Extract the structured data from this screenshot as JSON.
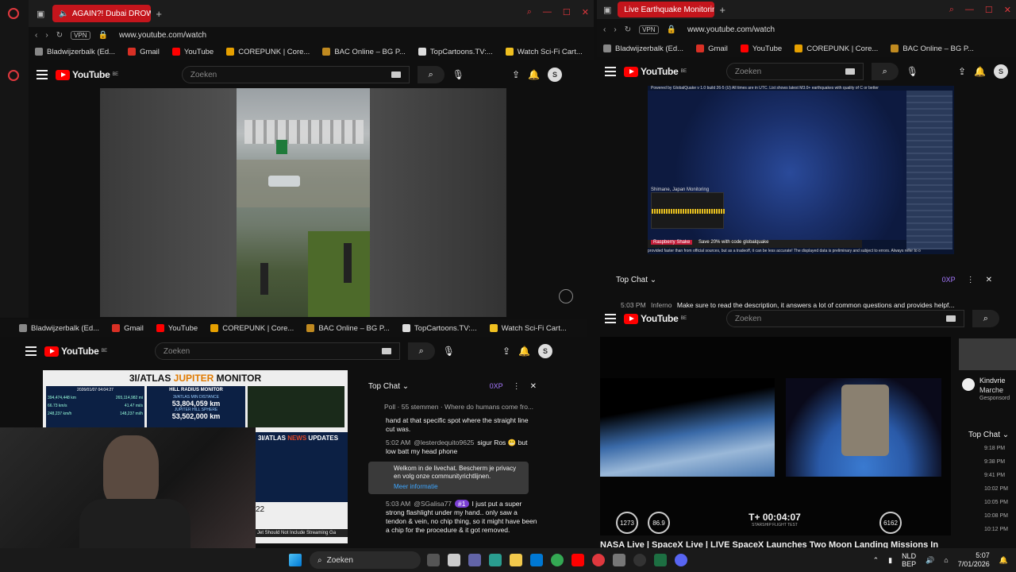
{
  "win1": {
    "tab_title": "AGAIN?! Dubai DROWN",
    "url": "www.youtube.com/watch",
    "vpn": "VPN",
    "bookmarks": [
      "Bladwijzerbalk (Ed...",
      "Gmail",
      "YouTube",
      "COREPUNK | Core...",
      "BAC Online – BG P...",
      "TopCartoons.TV:...",
      "Watch Sci-Fi Cart..."
    ],
    "search_placeholder": "Zoeken",
    "avatar": "S"
  },
  "win2": {
    "tab_title": "Live Earthquake Monitoring",
    "url": "www.youtube.com/watch",
    "vpn": "VPN",
    "bookmarks": [
      "Bladwijzerbalk (Ed...",
      "Gmail",
      "YouTube",
      "COREPUNK | Core...",
      "BAC Online – BG P..."
    ],
    "search_placeholder": "Zoeken",
    "avatar": "S",
    "video_banner": "Powered by GlobalQuake v 1.0 build 26-5 (U)     All times are in UTC. List shows latest M3.0+ earthquakes with quality of C or better",
    "shimane": "Shimane, Japan Monitoring",
    "promo": "Save 20% with code globalquake",
    "promo_brand": "Raspberry Shake",
    "footer_text": "provided faster than from official sources, but as a tradeoff, it can be less accurate! The displayed data is preliminary and subject to errors. Always refer to o",
    "chat_title": "Top Chat",
    "xp": "0XP",
    "pinned_time": "5:03 PM",
    "pinned_user": "Inferno",
    "pinned_msg": "Make sure to read the description, it answers a lot of common questions and provides helpf..."
  },
  "win3": {
    "bookmarks": [
      "Bladwijzerbalk (Ed...",
      "Gmail",
      "YouTube",
      "COREPUNK | Core...",
      "BAC Online – BG P...",
      "TopCartoons.TV:...",
      "Watch Sci-Fi Cart..."
    ],
    "search_placeholder": "Zoeken",
    "avatar": "S",
    "monitor_title_a": "3I/ATLAS ",
    "monitor_title_b": "JUPITER",
    "monitor_title_c": " MONITOR",
    "date_line": "2026/01/07 04:04:27",
    "hill_title": "HILL RADIUS MONITOR",
    "atlas_dist_label": "3I/ATLAS MIN DISTANCE",
    "atlas_dist": "53,804,059 km",
    "sphere_label": "JUPITER HILL SPHERE",
    "sphere_val": "53,502,000 km",
    "left_vals": [
      "394,474,448 km",
      "66.73 km/s",
      "248,237 km/h"
    ],
    "right_vals": [
      "265,114,982 mi",
      "41.47 mi/s",
      "148,237 mi/h"
    ],
    "news_a": "3I/ATLAS ",
    "news_b": "NEWS",
    "news_c": " UPDATES",
    "side_num": "22",
    "news_ticker": "Jet Should Not Include Streaming Ga",
    "chat_title": "Top Chat",
    "xp": "0XP",
    "messages": [
      {
        "time": "",
        "user": "Poll · 55 stemmen · Where do humans come fro...",
        "text": ""
      },
      {
        "time": "",
        "user": "",
        "text": "hand at that specific spot where the straight line cut was."
      },
      {
        "time": "5:02 AM",
        "user": "@lesterdequito9625",
        "text": "sigur Ros 😬 but low batt my head phone"
      },
      {
        "time": "5:03 AM",
        "user": "@SGalisa77",
        "text": "I just put a super strong flashlight under my hand.. only saw a tendon & vein, no chip thing, so it might have been a chip for the procedure & it got removed."
      }
    ],
    "welcome_msg": "Welkom in de livechat. Bescherm je privacy en volg onze communityrichtlijnen.",
    "welcome_link": "Meer informatie",
    "badge": "#1"
  },
  "win4": {
    "search_placeholder": "Zoeken",
    "telemetry_left": [
      "1273",
      "86.9"
    ],
    "telemetry_right": "6162",
    "timer": "T+ 00:04:07",
    "timer_sub": "STARSHIP FLIGHT TEST",
    "video_title": "NASA Live | SpaceX Live | LIVE SpaceX Launches Two Moon Landing Missions In",
    "side_name": "Kindvrie",
    "side_sub": "Marche",
    "side_sub2": "Gesponsord",
    "chat_title": "Top Chat",
    "chat_times": [
      "9:18 PM",
      "9:38 PM",
      "9:41 PM",
      "10:02 PM",
      "10:05 PM",
      "10:08 PM",
      "10:12 PM"
    ]
  },
  "taskbar": {
    "search": "Zoeken",
    "lang1": "NLD",
    "lang2": "BEP",
    "time": "5:07",
    "date": "7/01/2026"
  },
  "colors": {
    "accent_red": "#c4151c",
    "yt_red": "#ff0000",
    "purple": "#a678ff"
  }
}
